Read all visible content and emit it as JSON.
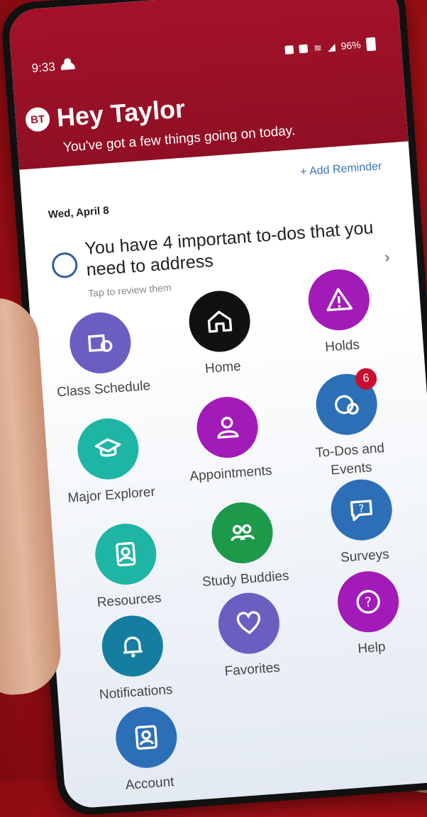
{
  "status": {
    "time": "9:33",
    "battery": "96%"
  },
  "header": {
    "initials": "BT",
    "title": "Hey Taylor",
    "subtitle": "You've got a few things going on today."
  },
  "reminder": {
    "add_label": "+ Add Reminder",
    "date": "Wed, April 8"
  },
  "todo": {
    "headline": "You have 4 important to-dos that you need to address",
    "hint": "Tap to review them",
    "chevron": "›"
  },
  "apps": [
    {
      "label": "Class Schedule",
      "color": "#6a5fc1",
      "icon": "schedule-icon"
    },
    {
      "label": "Home",
      "color": "#111111",
      "icon": "home-icon"
    },
    {
      "label": "Holds",
      "color": "#a21ab8",
      "icon": "warning-icon"
    },
    {
      "label": "Major Explorer",
      "color": "#1fb5a5",
      "icon": "graduation-cap-icon"
    },
    {
      "label": "Appointments",
      "color": "#a21ab8",
      "icon": "person-icon"
    },
    {
      "label": "To-Dos and Events",
      "color": "#2c6fb7",
      "icon": "todo-icon",
      "badge": "6"
    },
    {
      "label": "Resources",
      "color": "#1fb5a5",
      "icon": "resources-icon"
    },
    {
      "label": "Study Buddies",
      "color": "#1c9a4a",
      "icon": "study-buddies-icon"
    },
    {
      "label": "Surveys",
      "color": "#2c6fb7",
      "icon": "survey-icon"
    },
    {
      "label": "Notifications",
      "color": "#157ea0",
      "icon": "bell-icon"
    },
    {
      "label": "Favorites",
      "color": "#6a5fc1",
      "icon": "heart-icon"
    },
    {
      "label": "Help",
      "color": "#a21ab8",
      "icon": "help-icon"
    },
    {
      "label": "Account",
      "color": "#2c6fb7",
      "icon": "account-icon"
    }
  ]
}
